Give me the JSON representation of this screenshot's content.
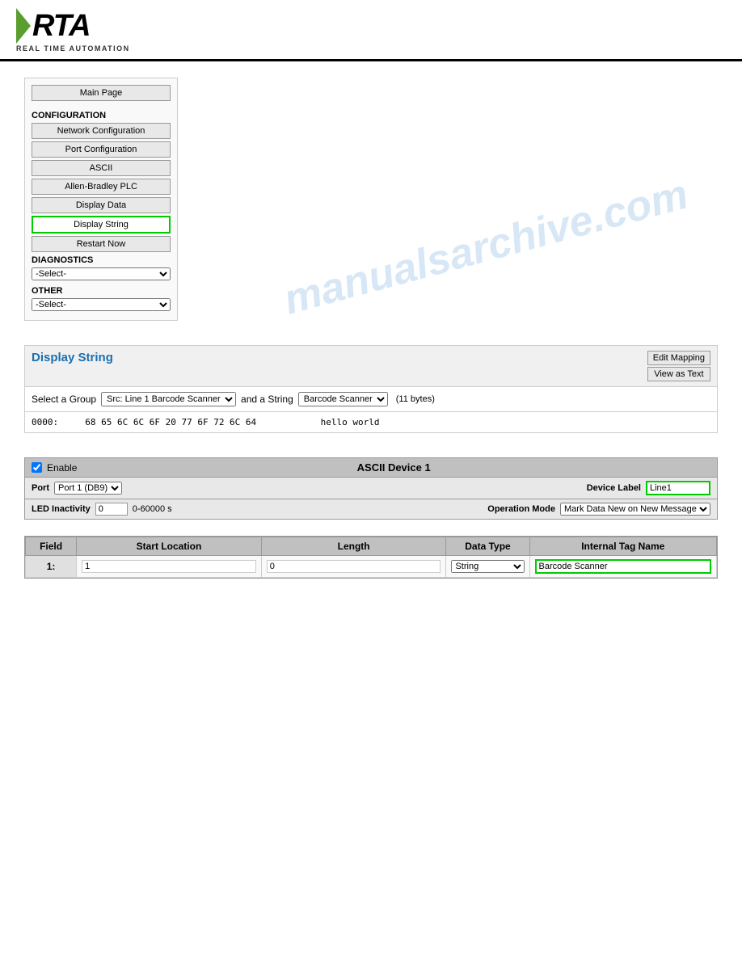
{
  "header": {
    "logo_text": "RTA",
    "logo_subtitle": "REAL TIME AUTOMATION"
  },
  "watermark": "manualsarchive.com",
  "nav": {
    "main_page_label": "Main Page",
    "configuration_label": "CONFIGURATION",
    "buttons": [
      {
        "label": "Network Configuration",
        "active": false
      },
      {
        "label": "Port Configuration",
        "active": false
      },
      {
        "label": "ASCII",
        "active": false
      },
      {
        "label": "Allen-Bradley PLC",
        "active": false
      },
      {
        "label": "Display Data",
        "active": false
      },
      {
        "label": "Display String",
        "active": true
      },
      {
        "label": "Restart Now",
        "active": false
      }
    ],
    "diagnostics_label": "DIAGNOSTICS",
    "diagnostics_select_default": "-Select-",
    "other_label": "OTHER",
    "other_select_default": "-Select-"
  },
  "display_string": {
    "title": "Display String",
    "btn_edit_mapping": "Edit Mapping",
    "btn_view_as_text": "View as Text",
    "group_label": "Select a Group",
    "group_value": "Src: Line 1 Barcode Scanner",
    "string_label": "and a String",
    "string_value": "Barcode Scanner",
    "bytes_label": "(11 bytes)",
    "data_offset": "0000:",
    "data_hex": "68 65 6C 6C 6F 20 77 6F 72 6C 64",
    "data_text": "hello world"
  },
  "ascii_device": {
    "enable_label": "Enable",
    "title": "ASCII Device 1",
    "port_label": "Port",
    "port_value": "Port 1 (DB9)",
    "device_label_label": "Device Label",
    "device_label_value": "Line1",
    "led_inactivity_label": "LED Inactivity",
    "led_inactivity_value": "0",
    "led_inactivity_range": "0-60000 s",
    "operation_mode_label": "Operation Mode",
    "operation_mode_value": "Mark Data New on New Message"
  },
  "field_table": {
    "columns": [
      "Field",
      "Start Location",
      "Length",
      "Data Type",
      "Internal Tag Name"
    ],
    "rows": [
      {
        "field_num": "1:",
        "start_location": "1",
        "length": "0",
        "data_type": "String",
        "internal_tag_name": "Barcode Scanner"
      }
    ]
  }
}
